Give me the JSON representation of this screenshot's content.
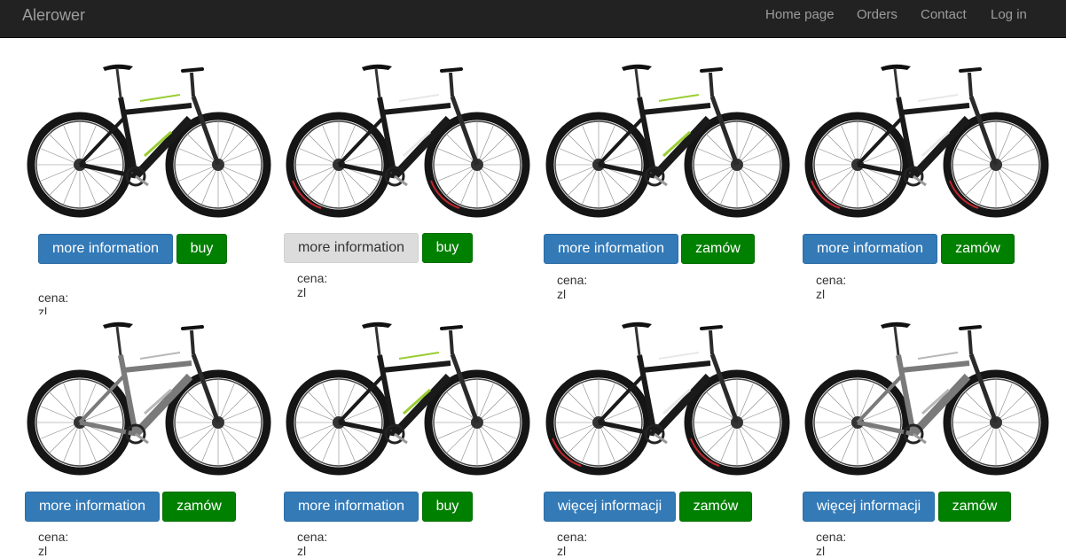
{
  "navbar": {
    "brand": "Alerower",
    "links": [
      "Home page",
      "Orders",
      "Contact",
      "Log in"
    ]
  },
  "colors": {
    "navbar_bg": "#222222",
    "primary": "#337ab7",
    "success": "#008000",
    "muted": "#dcdcdc",
    "bike_accent_green": "#9acd32",
    "bike_accent_white": "#e8e8e8"
  },
  "products": [
    {
      "info_label": "more information",
      "buy_label": "buy",
      "price_label": "cena: zl",
      "frame": "black-green",
      "info_state": "normal"
    },
    {
      "info_label": "more information",
      "buy_label": "buy",
      "price_label": "cena: zl",
      "frame": "black-white",
      "info_state": "hover"
    },
    {
      "info_label": "more information",
      "buy_label": "zamów",
      "price_label": "cena: zl",
      "frame": "black-green",
      "info_state": "normal"
    },
    {
      "info_label": "more information",
      "buy_label": "zamów",
      "price_label": "cena: zl",
      "frame": "black-white",
      "info_state": "normal"
    },
    {
      "info_label": "more information",
      "buy_label": "zamów",
      "price_label": "cena: zl",
      "frame": "grey",
      "info_state": "normal"
    },
    {
      "info_label": "more information",
      "buy_label": "buy",
      "price_label": "cena: zl",
      "frame": "black-green",
      "info_state": "normal"
    },
    {
      "info_label": "więcej informacji",
      "buy_label": "zamów",
      "price_label": "cena: zl",
      "frame": "black-white",
      "info_state": "normal"
    },
    {
      "info_label": "więcej informacji",
      "buy_label": "zamów",
      "price_label": "cena: zl",
      "frame": "grey",
      "info_state": "normal"
    }
  ]
}
